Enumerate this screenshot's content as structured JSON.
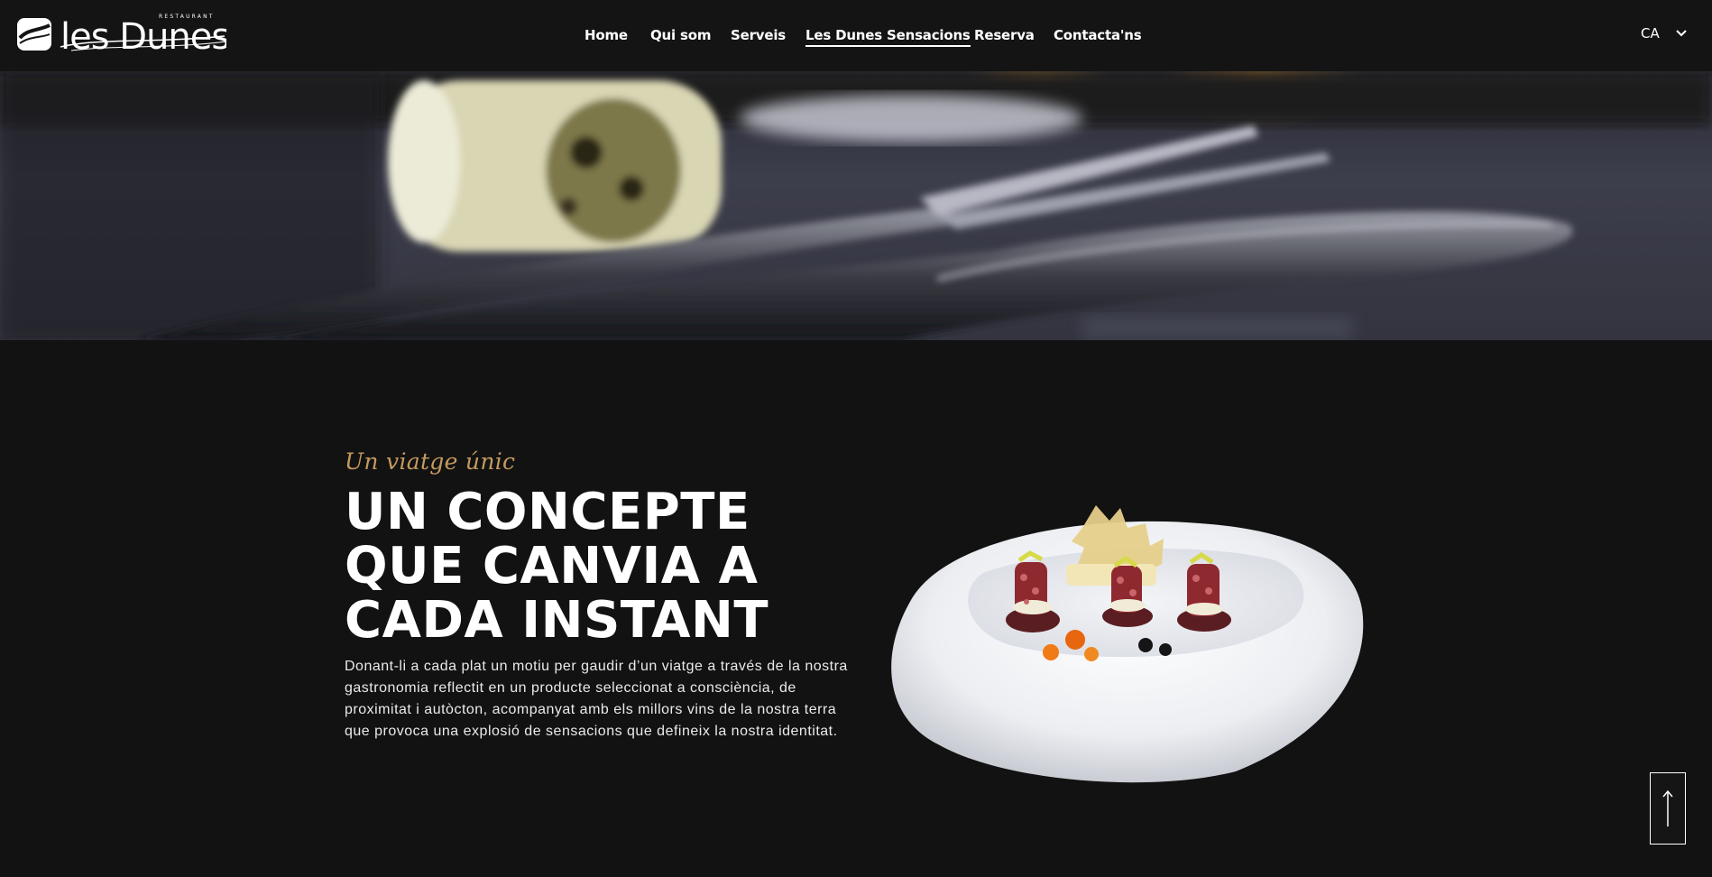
{
  "header": {
    "logo_text": "les Dunes",
    "logo_tagline": "RESTAURANT",
    "nav": [
      {
        "label": "Home",
        "active": false
      },
      {
        "label": "Qui som",
        "active": false
      },
      {
        "label": "Serveis",
        "active": false
      },
      {
        "label": "Les Dunes Sensacions",
        "active": true
      },
      {
        "label": "Reserva",
        "active": false
      },
      {
        "label": "Contacta'ns",
        "active": false
      }
    ],
    "language": "CA"
  },
  "hero": {
    "image_subject": "blurred table setting with bread roll, fork and knife"
  },
  "section": {
    "kicker": "Un viatge únic",
    "headline_lines": [
      "UN CONCEPTE",
      "QUE CANVIA A",
      "CADA INSTANT"
    ],
    "description": "Donant-li a cada plat un motiu per gaudir d’un viatge a través de la nostra gastronomia reflectit en un producte seleccionat a consciència, de proximitat i autòcton, acompanyat amb els millors vins de la nostra terra que provoca una explosió de sensacions que defineix la nostra identitat."
  },
  "colors": {
    "background": "#121212",
    "header_bg": "#141414",
    "accent": "#c49a5e",
    "text": "#ffffff"
  },
  "icons": {
    "language_dropdown": "chevron-down-icon",
    "back_to_top": "arrow-up-icon"
  }
}
